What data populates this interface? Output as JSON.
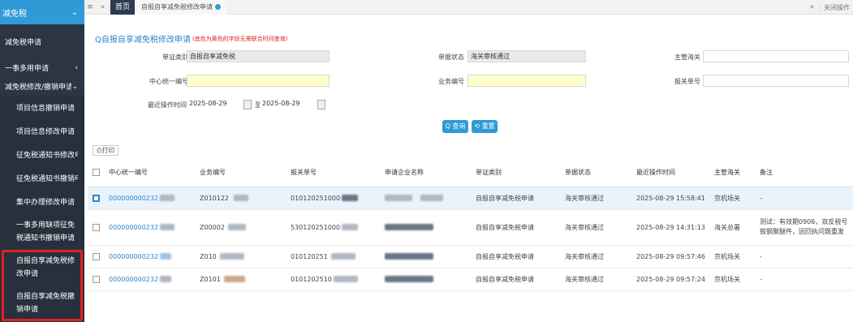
{
  "sidebar": {
    "header": "减免税",
    "header_icon": "chevron-down-icon",
    "items": [
      {
        "label": "减免税申请",
        "arrow": ""
      },
      {
        "label": "一事多用申请",
        "arrow": "‹"
      },
      {
        "label": "减免税修改/撤销申请",
        "arrow": "⌄"
      },
      {
        "label": "项目信息撤销申请",
        "arrow": ""
      },
      {
        "label": "项目信息修改申请",
        "arrow": ""
      },
      {
        "label": "征免税通知书修改申请",
        "arrow": ""
      },
      {
        "label": "征免税通知书撤销申请",
        "arrow": ""
      },
      {
        "label": "集中办理修改申请",
        "arrow": ""
      },
      {
        "label": "一事多用缺项征免税通知书撤销申请",
        "arrow": ""
      },
      {
        "label": "自报自享减免税修改申请",
        "arrow": ""
      },
      {
        "label": "自报自享减免税撤销申请",
        "arrow": ""
      }
    ]
  },
  "tabbar": {
    "menu_icon": "≡",
    "back_icon": "«",
    "home": "首页",
    "current": "自报自享减免税修改申请",
    "forward_icon": "»",
    "close_label": "关闭操作"
  },
  "search": {
    "title": "Q自报自享减免税修改申请",
    "note": "(底色为黄色的字段无需联合时间查询)",
    "doc_type_label": "单证类别",
    "doc_type_value": "自报自享减免税",
    "status_label": "单据状态",
    "status_value": "海关审核通过",
    "customs_label": "主管海关",
    "customs_value": "",
    "central_no_label": "中心统一编号",
    "central_no_value": "",
    "biz_no_label": "业务编号",
    "biz_no_value": "",
    "decl_no_label": "报关单号",
    "decl_no_value": "",
    "time_label": "最近操作时间",
    "date_from": "2025-08-29",
    "to_label": "至",
    "date_to": "2025-08-29",
    "query_btn": "Q 查询",
    "reset_btn": "⟲ 重置",
    "print_btn": "⎙打印"
  },
  "table": {
    "headers": [
      "中心统一编号",
      "业务编号",
      "报关单号",
      "申请企业名称",
      "单证类别",
      "单据状态",
      "最近操作时间",
      "主管海关",
      "备注"
    ],
    "rows": [
      {
        "central": "000000000232",
        "biz": "Z010122",
        "decl": "010120251000",
        "doc_type": "自报自享减免税申请",
        "status": "海关审核通过",
        "time": "2025-08-29 15:58:41",
        "customs": "京机场关",
        "note": "-",
        "checked": true
      },
      {
        "central": "000000000232",
        "biz": "Z00002",
        "decl": "530120251000",
        "doc_type": "自报自享减免税申请",
        "status": "海关审核通过",
        "time": "2025-08-29 14:31:13",
        "customs": "海关总署",
        "note": "测试：有效期0906，双反税号鼓钢聚醚件，因回执问题重发",
        "checked": false
      },
      {
        "central": "000000000232",
        "biz": "Z010",
        "decl": "010120251",
        "doc_type": "自报自享减免税申请",
        "status": "海关审核通过",
        "time": "2025-08-29 09:57:46",
        "customs": "京机场关",
        "note": "-",
        "checked": false
      },
      {
        "central": "000000000232",
        "biz": "Z0101",
        "decl": "0101202510",
        "doc_type": "自报自享减免税申请",
        "status": "海关审核通过",
        "time": "2025-08-29 09:57:24",
        "customs": "京机场关",
        "note": "-",
        "checked": false
      }
    ]
  },
  "colors": {
    "accent": "#2f9ad6",
    "sidebar_bg": "#2b3543",
    "highlight": "#e02020",
    "required_bg": "#ffffcc"
  }
}
